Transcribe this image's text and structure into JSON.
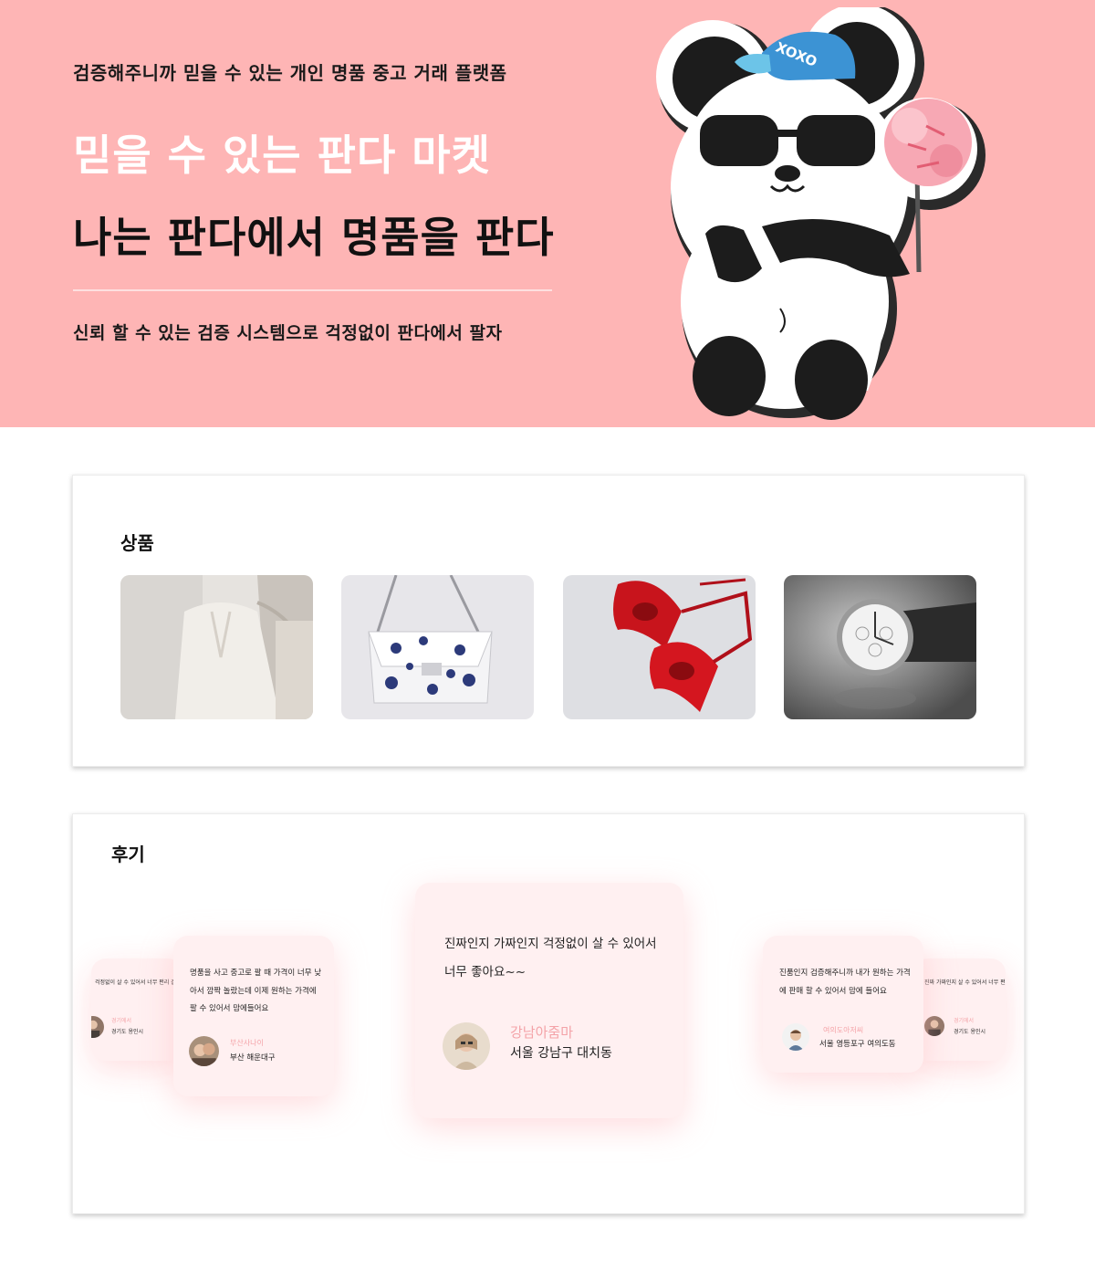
{
  "hero": {
    "tagline": "검증해주니까 믿을 수 있는 개인 명품 중고 거래 플랫폼",
    "title_line1": "믿을 수 있는 판다 마켓",
    "title_line2": "나는 판다에서 명품을 판다",
    "subtitle": "신뢰 할 수 있는 검증 시스템으로 걱정없이 판다에서 팔자",
    "mascot_cap_text": "XOXO",
    "background_color": "#feb5b5"
  },
  "products": {
    "title": "상품",
    "items": [
      {
        "name": "coat",
        "icon": "coat-photo"
      },
      {
        "name": "handbag",
        "icon": "handbag-photo"
      },
      {
        "name": "red-heels",
        "icon": "heels-photo"
      },
      {
        "name": "wristwatch",
        "icon": "watch-photo"
      }
    ]
  },
  "reviews": {
    "title": "후기",
    "items": [
      {
        "position": "far-left",
        "text": "걱정없이 살 수 있어서 너무 편리 갈아요 앞으로 자주 이용할게요",
        "author": "경기에서",
        "location": "경기도 용인시"
      },
      {
        "position": "left",
        "text": "명품을 사고 중고로 팔 때 가격이 너무 낮아서 깜짝 놀랐는데 이제 원하는 가격에 팔 수 있어서 맘에들어요",
        "author": "부산사나이",
        "location": "부산 해운대구"
      },
      {
        "position": "center",
        "text": "진짜인지 가짜인지 걱정없이 살 수 있어서 너무 좋아요~~",
        "author": "강남아줌마",
        "location": "서울 강남구 대치동"
      },
      {
        "position": "right",
        "text": "진품인지 검증해주니까 내가 원하는 가격에 판매 할 수 있어서 맘에 들어요",
        "author": "여의도아저씨",
        "location": "서울 영등포구 여의도동"
      },
      {
        "position": "far-right",
        "text": "진짜 가짜인지 살 수 있어서 너무 편한것 같아요 앞으로 자주 이용할게요",
        "author": "경기에서",
        "location": "경기도 용인시"
      }
    ]
  }
}
